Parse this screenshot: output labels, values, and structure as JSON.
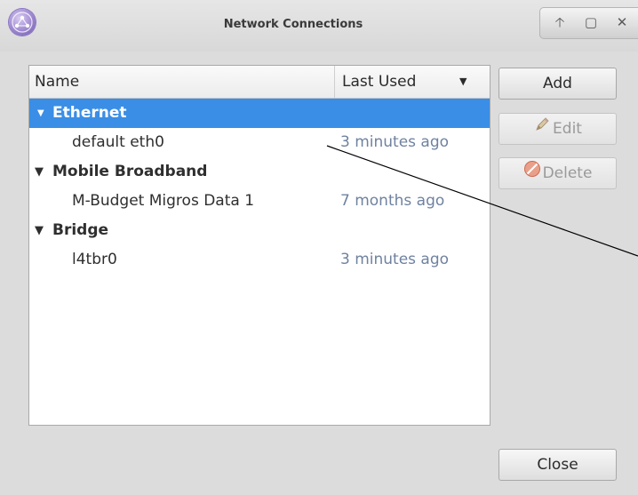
{
  "window": {
    "title": "Network Connections",
    "controls": {
      "maximize_glyph": "🡡",
      "restore_glyph": "▢",
      "close_glyph": "✕"
    }
  },
  "table": {
    "columns": {
      "name": "Name",
      "last_used": "Last Used",
      "sort_indicator": "▼"
    },
    "groups": [
      {
        "label": "Ethernet",
        "expander": "▼",
        "selected": true,
        "connections": [
          {
            "name": "default eth0",
            "last_used": "3 minutes ago"
          }
        ]
      },
      {
        "label": "Mobile Broadband",
        "expander": "▼",
        "selected": false,
        "connections": [
          {
            "name": "M-Budget Migros Data 1",
            "last_used": "7 months ago"
          }
        ]
      },
      {
        "label": "Bridge",
        "expander": "▼",
        "selected": false,
        "connections": [
          {
            "name": "l4tbr0",
            "last_used": "3 minutes ago"
          }
        ]
      }
    ]
  },
  "buttons": {
    "add": "Add",
    "edit": "Edit",
    "delete": "Delete",
    "close": "Close"
  },
  "icons": {
    "app": "network-icon",
    "edit": "pencil-icon",
    "delete": "no-entry-icon"
  },
  "colors": {
    "selection": "#3a8ee6",
    "timestamp": "#6f82a0",
    "delete_icon": "#e06040"
  }
}
